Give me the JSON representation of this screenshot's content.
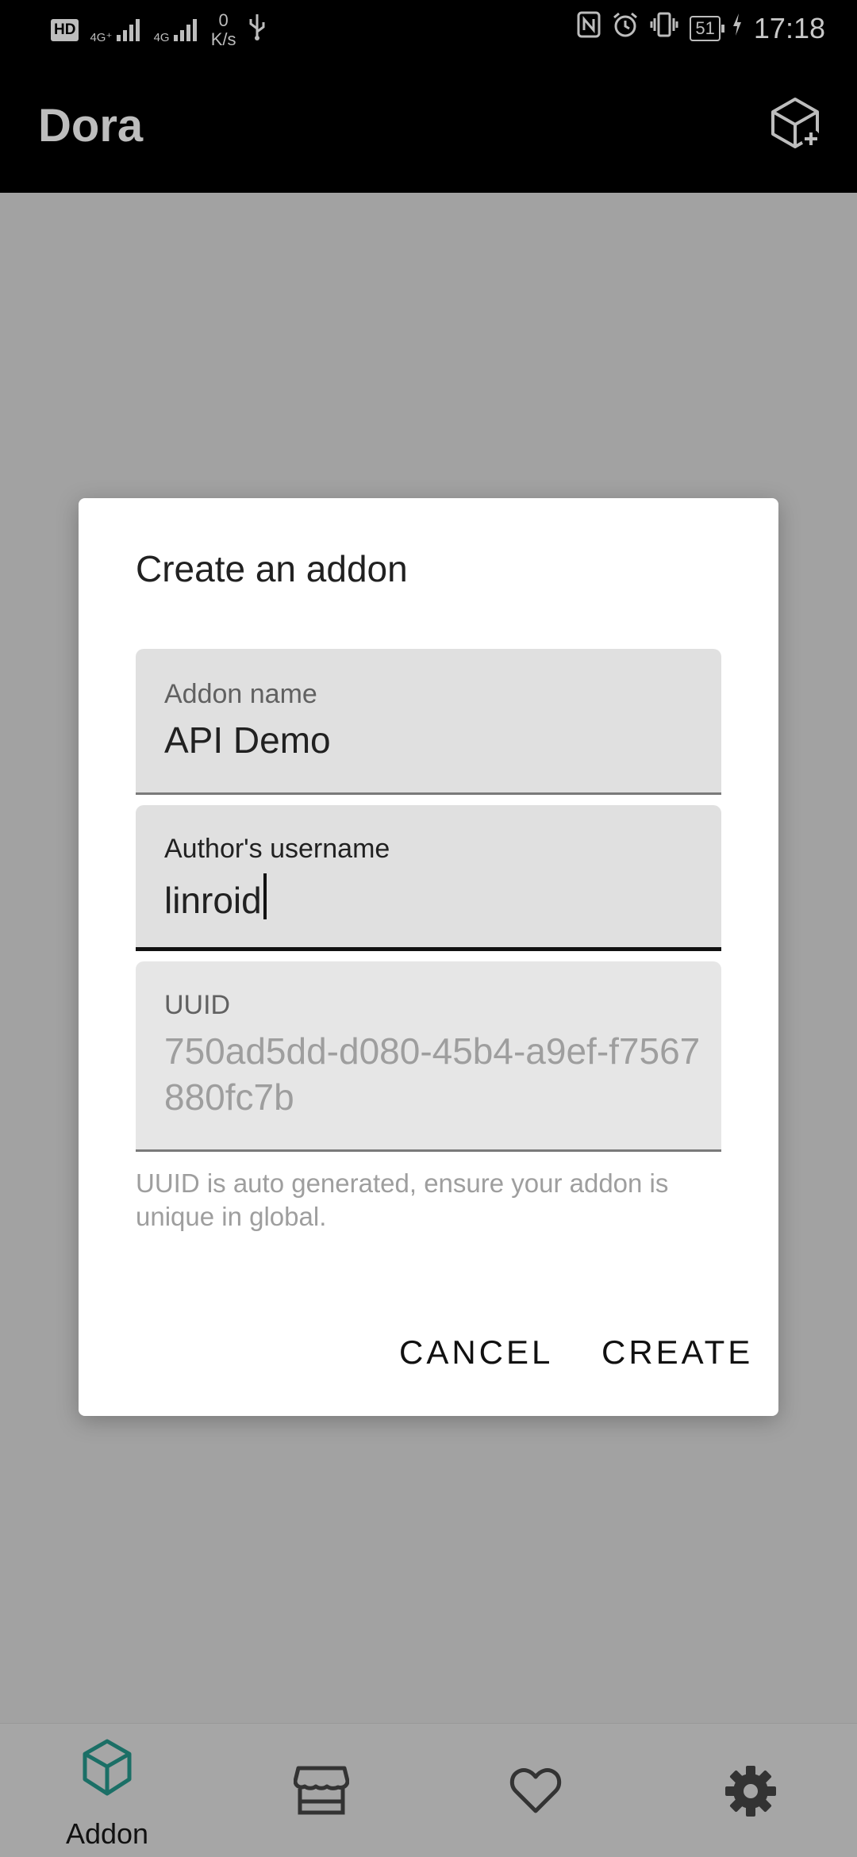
{
  "status_bar": {
    "hd": "HD",
    "signal1": "4G⁺",
    "signal2": "4G",
    "net_speed_value": "0",
    "net_speed_unit": "K/s",
    "battery": "51",
    "time": "17:18"
  },
  "app_bar": {
    "title": "Dora",
    "action_icon": "add-cube-icon"
  },
  "dialog": {
    "title": "Create an addon",
    "fields": {
      "addon_name": {
        "label": "Addon name",
        "value": "API Demo"
      },
      "author": {
        "label": "Author's username",
        "value": "linroid"
      },
      "uuid": {
        "label": "UUID",
        "value": "750ad5dd-d080-45b4-a9ef-f7567880fc7b"
      }
    },
    "helper": "UUID is auto generated, ensure your addon is unique in global.",
    "cancel_label": "CANCEL",
    "create_label": "CREATE"
  },
  "bottom_nav": {
    "items": [
      {
        "label": "Addon",
        "icon": "cube-icon",
        "active": true
      },
      {
        "label": "",
        "icon": "store-icon",
        "active": false
      },
      {
        "label": "",
        "icon": "heart-icon",
        "active": false
      },
      {
        "label": "",
        "icon": "gear-icon",
        "active": false
      }
    ],
    "active_color": "#1b6f66"
  }
}
